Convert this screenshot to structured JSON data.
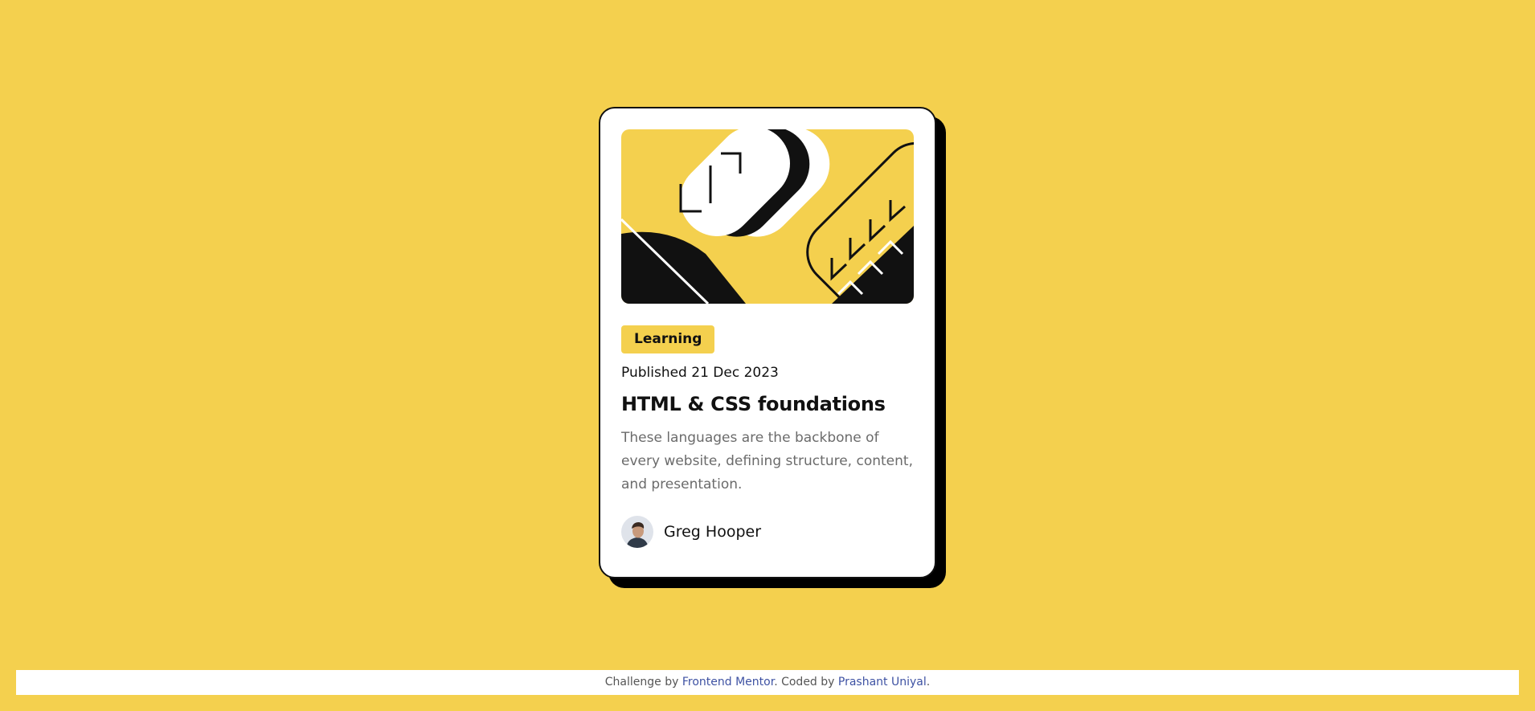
{
  "card": {
    "category": "Learning",
    "published": "Published 21 Dec 2023",
    "title": "HTML & CSS foundations",
    "description": "These languages are the backbone of every website, defining structure, content, and presentation.",
    "author": {
      "name": "Greg Hooper"
    }
  },
  "attribution": {
    "prefix": "Challenge by ",
    "challenge_link": "Frontend Mentor",
    "middle": ". Coded by ",
    "author_link": "Prashant Uniyal",
    "suffix": "."
  },
  "colors": {
    "background": "#f4d04e",
    "card": "#ffffff",
    "ink": "#111111",
    "muted_text": "#6b6b6b",
    "link": "#3e52a3"
  }
}
